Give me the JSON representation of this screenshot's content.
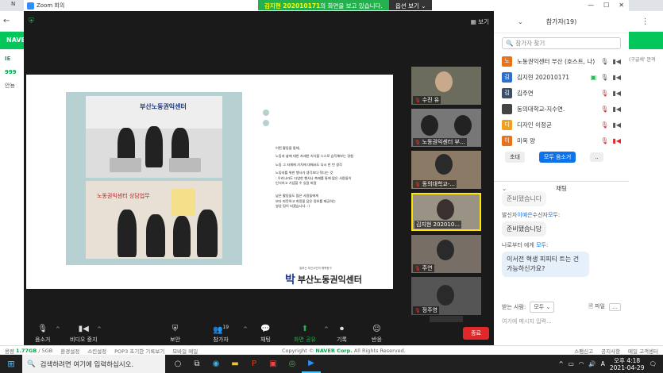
{
  "background_browser": {
    "tab_partial": "N",
    "naver_label": "NAVER",
    "sidebar_partial": [
      "IE",
      "999",
      "안뇽"
    ],
    "right_text": "(구글세' 본격"
  },
  "zoom": {
    "window_title": "Zoom 회의",
    "share_banner": {
      "name": "김지현 202010171",
      "message": "의 화면을 보고 있습니다.",
      "options_label": "옵션 보기"
    },
    "view_label": "보기",
    "slide": {
      "logo_text": "부산노동권익센터",
      "sign_text": "노동권익센터 상담업무",
      "paragraphs": [
        "어떤 활동을 통해,",
        "노동과 삶에 대한 자세한 지식을 스스로 습득해보는 경험",
        "노동 그 자체에 가치에 대해서도 다시 한 번 생각",
        "노동자를 위한 행사가 생각보다 적다는 것\n: 우리나라도 다양한 행사나 축제를 통해 많은 사람들이\n인식하고 기념할 수 있길 바람",
        "남은 활동들도 많은 사람들에게\n보다 따뜻하고 희망을 담은 정보를 제공하는\n영상 팀이 되겠습니다. :)"
      ],
      "brand_sub": "일하는 부산시민의 행복동구",
      "brand_mark": "박",
      "brand_name": "부산노동권익센터"
    },
    "thumbnails": [
      {
        "label": "수진 유",
        "muted": true
      },
      {
        "label": "노동권익센터 부...",
        "muted": true
      },
      {
        "label": "동의대학교-...",
        "muted": true
      },
      {
        "label": "김지현 202010...",
        "muted": false,
        "active": true
      },
      {
        "label": "주연",
        "muted": true
      },
      {
        "label": "정주영",
        "muted": true
      }
    ],
    "toolbar": {
      "mute_label": "음소거",
      "video_label": "비디오 중지",
      "security_label": "보안",
      "participants_label": "참가자",
      "participants_count": "19",
      "chat_label": "채팅",
      "share_label": "화면 공유",
      "record_label": "기록",
      "reactions_label": "반응",
      "end_label": "종료"
    },
    "participants_panel": {
      "title": "참가자(19)",
      "search_placeholder": "참가자 찾기",
      "people": [
        {
          "initial": "노",
          "name": "노동권익센터 부산 (호스트, 나)",
          "color": "#e8711a",
          "mic": "on",
          "video": "on"
        },
        {
          "initial": "김",
          "name": "김지현 202010171",
          "color": "#2c6fd1",
          "mic": "on",
          "video": "sharing"
        },
        {
          "initial": "김",
          "name": "김주연",
          "color": "#3d4f68",
          "mic": "off",
          "video": "on"
        },
        {
          "initial": "",
          "name": "동의대학교-지수연.",
          "color": "#444444",
          "mic": "off",
          "video": "on"
        },
        {
          "initial": "디",
          "name": "디자인 이정균",
          "color": "#f0a020",
          "mic": "off",
          "video": "on"
        },
        {
          "initial": "이",
          "name": "미옥 양",
          "color": "#e8711a",
          "mic": "off",
          "video": "off"
        }
      ],
      "invite_label": "초대",
      "mute_all_label": "모두 음소거",
      "more_label": ".."
    },
    "chat_panel": {
      "title": "채팅",
      "partial_top": "준비됐습니다",
      "messages": [
        {
          "from_prefix": "발신자",
          "from_name": "이예은",
          "to": "수신자",
          "to_name": "모두",
          "text": "준비됐습니당"
        },
        {
          "from_prefix": "나로부터 에게 ",
          "from_name": "",
          "to": "",
          "to_name": "모두",
          "text": "이서전 혁생 피피티 트는 건 가능하신가요?"
        }
      ],
      "send_to_label": "받는 사람:",
      "send_to_value": "모두",
      "file_label": "파일",
      "input_placeholder": "여기에 메시지 입력..."
    }
  },
  "status_bar": {
    "usage_label": "용량",
    "usage_value": "1.77GB",
    "usage_total": "/ 5GB",
    "items": [
      "환경설정",
      "스킨설정",
      "POP3 초기한 기록보기",
      "모바일 메일"
    ],
    "copyright_prefix": "Copyright ©",
    "copyright_brand": "NAVER Corp.",
    "copyright_suffix": "All Rights Reserved.",
    "right_items": [
      "스팸신고",
      "공지사항",
      "메일 고객센터"
    ]
  },
  "taskbar": {
    "search_placeholder": "검색하려면 여기에 입력하십시오.",
    "time": "오후 4:18",
    "date": "2021-04-29",
    "lang": "A"
  }
}
